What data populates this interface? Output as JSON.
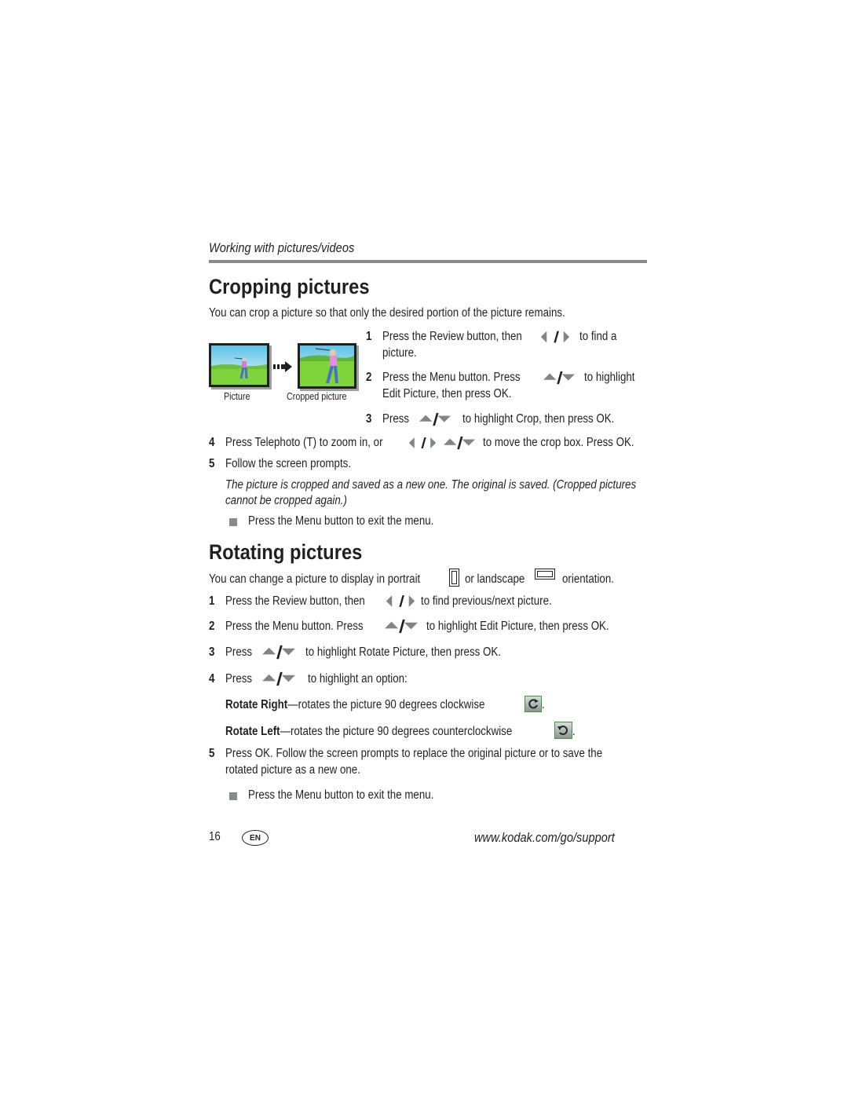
{
  "running_head": "Working with pictures/videos",
  "cropping": {
    "title": "Cropping pictures",
    "intro": "You can crop a picture so that only the desired portion of the picture remains.",
    "images": [
      {
        "caption": "Picture"
      },
      {
        "caption": "Cropped picture"
      }
    ],
    "steps": [
      {
        "num": "1",
        "text_a": "Press the Review button, then",
        "text_b": "to find a",
        "text_c": "picture."
      },
      {
        "num": "2",
        "text_a": "Press the Menu button. Press",
        "text_b": "to highlight",
        "text_c": "Edit Picture, then press OK."
      },
      {
        "num": "3",
        "text_a": "Press",
        "text_b": "to highlight Crop, then press OK."
      },
      {
        "num": "4",
        "text_a": "Press Telephoto (T) to zoom in, or",
        "text_b": "to move the crop box. Press OK."
      },
      {
        "num": "5",
        "text_a": "Follow the screen prompts."
      }
    ],
    "note_line1": "The picture is cropped and saved as a new one. The original is saved. (Cropped pictures",
    "note_line2": "cannot be cropped again.)",
    "bullet": "Press the Menu button to exit the menu."
  },
  "rotating": {
    "title": "Rotating pictures",
    "intro_a": "You can change a picture to display in portrait",
    "intro_b": "or landscape",
    "intro_c": "orientation.",
    "steps": [
      {
        "num": "1",
        "text_a": "Press the Review button, then",
        "text_b": "to find previous/next picture."
      },
      {
        "num": "2",
        "text_a": "Press the Menu button. Press",
        "text_b": "to highlight Edit Picture, then press OK."
      },
      {
        "num": "3",
        "text_a": "Press",
        "text_b": "to highlight Rotate Picture, then press OK."
      },
      {
        "num": "4",
        "text_a": "Press",
        "text_b": "to highlight an option:"
      },
      {
        "num": "5",
        "text_a": "Press OK. Follow the screen prompts to replace the original picture or to save the",
        "text_b": "rotated picture as a new one."
      }
    ],
    "options": [
      {
        "label": "Rotate Right",
        "desc": "—rotates the picture 90 degrees clockwise",
        "end": "."
      },
      {
        "label": "Rotate Left",
        "desc": "—rotates the picture 90 degrees counterclockwise",
        "end": "."
      }
    ],
    "bullet": "Press the Menu button to exit the menu."
  },
  "footer": {
    "page_number": "16",
    "language_badge": "EN",
    "url": "www.kodak.com/go/support"
  },
  "colors": {
    "rule": "#858c89",
    "arrow": "#7f8784",
    "icon_green": "#3a9a3a"
  }
}
